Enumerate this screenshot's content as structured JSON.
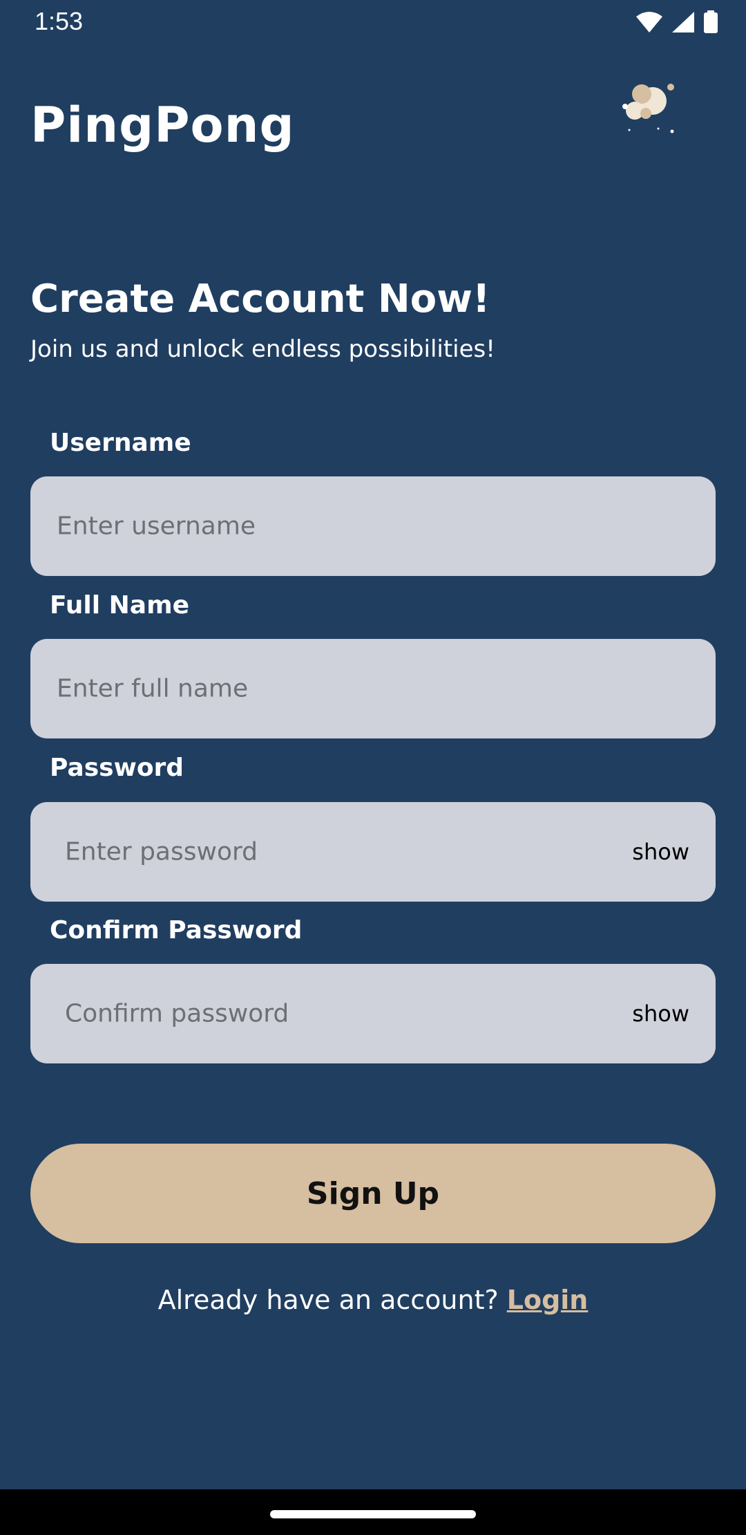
{
  "status_bar": {
    "time": "1:53"
  },
  "header": {
    "app_title": "PingPong",
    "logo_icon": "bubbles-logo-icon"
  },
  "intro": {
    "headline": "Create Account Now!",
    "subheadline": "Join us and unlock endless possibilities!"
  },
  "form": {
    "username": {
      "label": "Username",
      "placeholder": "Enter username",
      "value": ""
    },
    "full_name": {
      "label": "Full Name",
      "placeholder": "Enter full name",
      "value": ""
    },
    "password": {
      "label": "Password",
      "placeholder": "Enter password",
      "value": "",
      "toggle_label": "show"
    },
    "confirm_password": {
      "label": "Confirm Password",
      "placeholder": "Confirm password",
      "value": "",
      "toggle_label": "show"
    },
    "submit_label": "Sign Up"
  },
  "footer": {
    "prompt": "Already have an account?",
    "login_label": "Login"
  },
  "colors": {
    "background": "#203e60",
    "field": "#cfd1db",
    "accent": "#d6bea0"
  }
}
